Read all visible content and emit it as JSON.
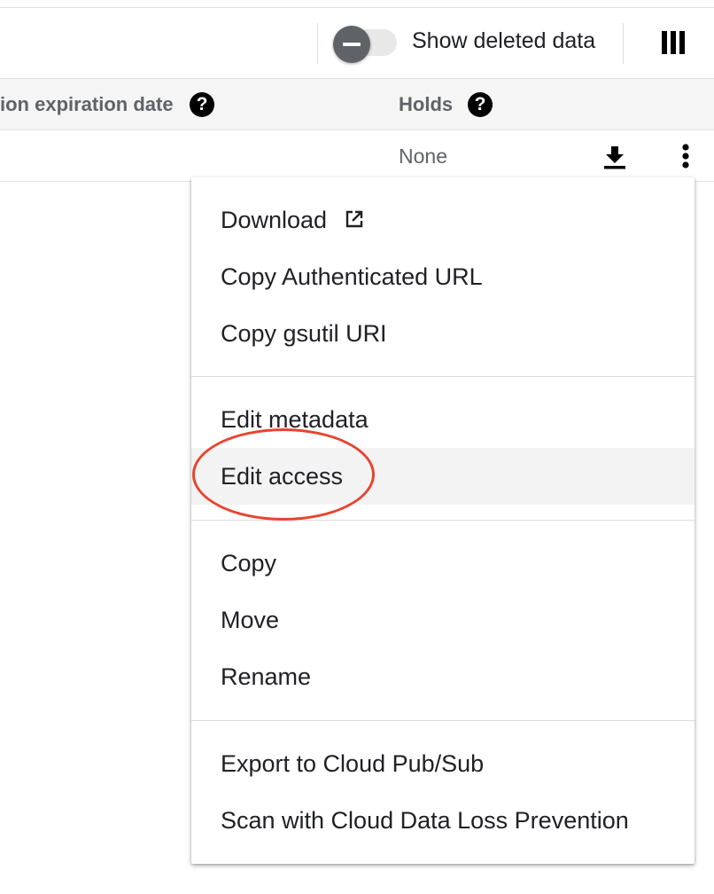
{
  "toolbar": {
    "show_deleted_label": "Show deleted data",
    "toggle_state": "off"
  },
  "table": {
    "columns": [
      {
        "label": "ion expiration date",
        "help": "?"
      },
      {
        "label": "Holds",
        "help": "?"
      }
    ],
    "rows": [
      {
        "holds": "None"
      }
    ]
  },
  "menu": {
    "groups": [
      [
        {
          "label": "Download",
          "icon": "external-link-icon"
        },
        {
          "label": "Copy Authenticated URL"
        },
        {
          "label": "Copy gsutil URI"
        }
      ],
      [
        {
          "label": "Edit metadata"
        },
        {
          "label": "Edit access",
          "highlighted": true
        }
      ],
      [
        {
          "label": "Copy"
        },
        {
          "label": "Move"
        },
        {
          "label": "Rename"
        }
      ],
      [
        {
          "label": "Export to Cloud Pub/Sub"
        },
        {
          "label": "Scan with Cloud Data Loss Prevention"
        }
      ]
    ]
  },
  "colors": {
    "annotation": "#e8442f",
    "highlight": "#f3f3f3",
    "header_bg": "#f5f5f5"
  }
}
